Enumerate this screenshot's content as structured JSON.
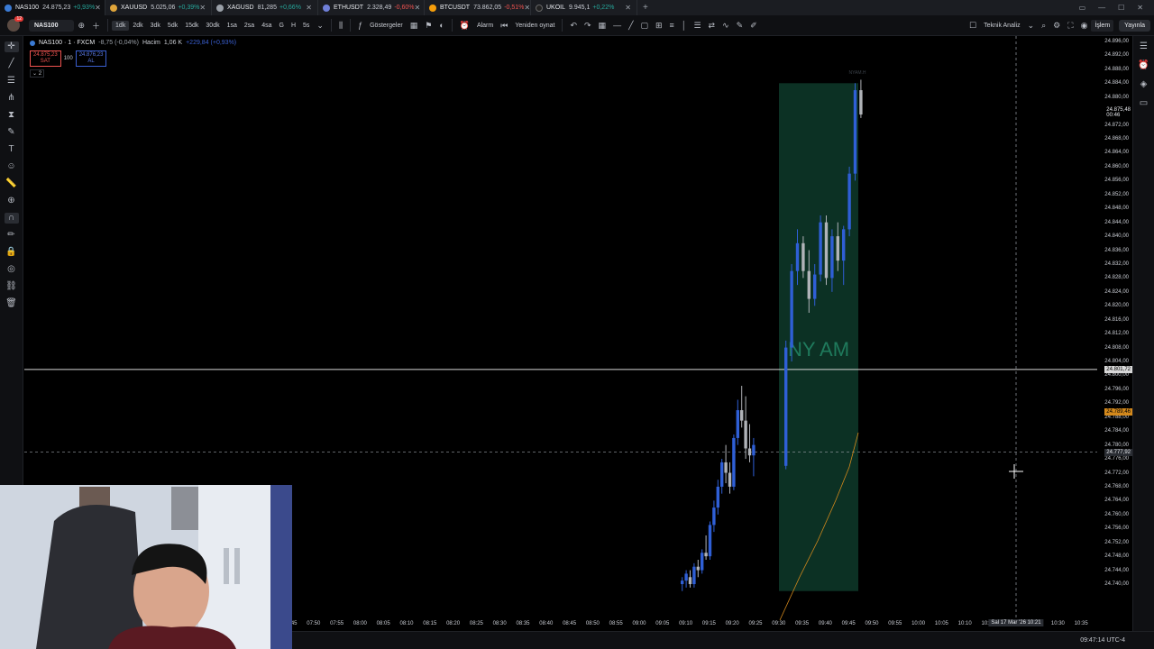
{
  "tabs": [
    {
      "symbol": "NAS100",
      "price": "24.875,23",
      "change": "+0,93%",
      "dir": "up",
      "color": "#3a7bd5",
      "active": true
    },
    {
      "symbol": "XAUUSD",
      "price": "5.025,06",
      "change": "+0,39%",
      "dir": "up",
      "color": "#e0a53a"
    },
    {
      "symbol": "XAGUSD",
      "price": "81,285",
      "change": "+0,66%",
      "dir": "up",
      "color": "#9aa0a8"
    },
    {
      "symbol": "ETHUSDT",
      "price": "2.328,49",
      "change": "-0,60%",
      "dir": "dn",
      "color": "#6f7fd8"
    },
    {
      "symbol": "BTCUSDT",
      "price": "73.862,05",
      "change": "-0,51%",
      "dir": "dn",
      "color": "#f59e0b"
    },
    {
      "symbol": "UKOIL",
      "price": "9.945,1",
      "change": "+0,22%",
      "dir": "up",
      "color": "#222"
    }
  ],
  "toolbar": {
    "symbol": "NAS100",
    "avatar_badge": "12",
    "intervals": [
      "1dk",
      "2dk",
      "3dk",
      "5dk",
      "15dk",
      "30dk",
      "1sa",
      "2sa",
      "4sa",
      "G",
      "H",
      "5s"
    ],
    "active_interval": "1dk",
    "indicators": "Göstergeler",
    "alarm": "Alarm",
    "replay": "Yeniden oynat",
    "analysis": "Teknik Analiz",
    "trade": "İşlem",
    "publish": "Yayınla"
  },
  "legend": {
    "symbol": "NAS100 · 1 · FXCM",
    "change": "-8,75 (-0,04%)",
    "volume_label": "Hacim",
    "volume": "1,06 K",
    "volume_extra": "+229,84 (+0,93%)",
    "sell_price": "24.875,23",
    "sell_label": "SAT",
    "spread": "100",
    "buy_price": "24.876,23",
    "buy_label": "AL",
    "collapse_count": "2"
  },
  "session": {
    "label": "NY AM",
    "small_label": "NYAM.H"
  },
  "price_axis": {
    "ticks": [
      "24.896,00",
      "24.892,00",
      "24.888,00",
      "24.884,00",
      "24.880,00",
      "24.876,00",
      "24.872,00",
      "24.868,00",
      "24.864,00",
      "24.860,00",
      "24.856,00",
      "24.852,00",
      "24.848,00",
      "24.844,00",
      "24.840,00",
      "24.836,00",
      "24.832,00",
      "24.828,00",
      "24.824,00",
      "24.820,00",
      "24.816,00",
      "24.812,00",
      "24.808,00",
      "24.804,00",
      "24.800,00",
      "24.796,00",
      "24.792,00",
      "24.788,00",
      "24.784,00",
      "24.780,00",
      "24.776,00",
      "24.772,00",
      "24.768,00",
      "24.764,00",
      "24.760,00",
      "24.756,00",
      "24.752,00",
      "24.748,00",
      "24.744,00",
      "24.740,00"
    ],
    "last_price": "24.875,48",
    "countdown": "00:46",
    "hline_price": "24.801,72",
    "orange_price": "24.789,46",
    "cursor_price": "24.777,92"
  },
  "time_axis": {
    "labels": [
      "07:45",
      "07:50",
      "07:55",
      "08:00",
      "08:05",
      "08:10",
      "08:15",
      "08:20",
      "08:25",
      "08:30",
      "08:35",
      "08:40",
      "08:45",
      "08:50",
      "08:55",
      "09:00",
      "09:05",
      "09:10",
      "09:15",
      "09:20",
      "09:25",
      "09:30",
      "09:35",
      "09:40",
      "09:45",
      "09:50",
      "09:55",
      "10:00",
      "10:05",
      "10:10",
      "10:15",
      "10:20",
      "10:25",
      "10:30",
      "10:35"
    ],
    "cursor_label": "Sal 17 Mar '26   10:21"
  },
  "status": {
    "clock": "09:47:14 UTC-4"
  },
  "colors": {
    "bull": "#2f5fd6",
    "bear": "#b0b3b8",
    "session_fill": "#0e3a2a",
    "orange": "#d4891c",
    "hline": "#d8d8d8"
  }
}
